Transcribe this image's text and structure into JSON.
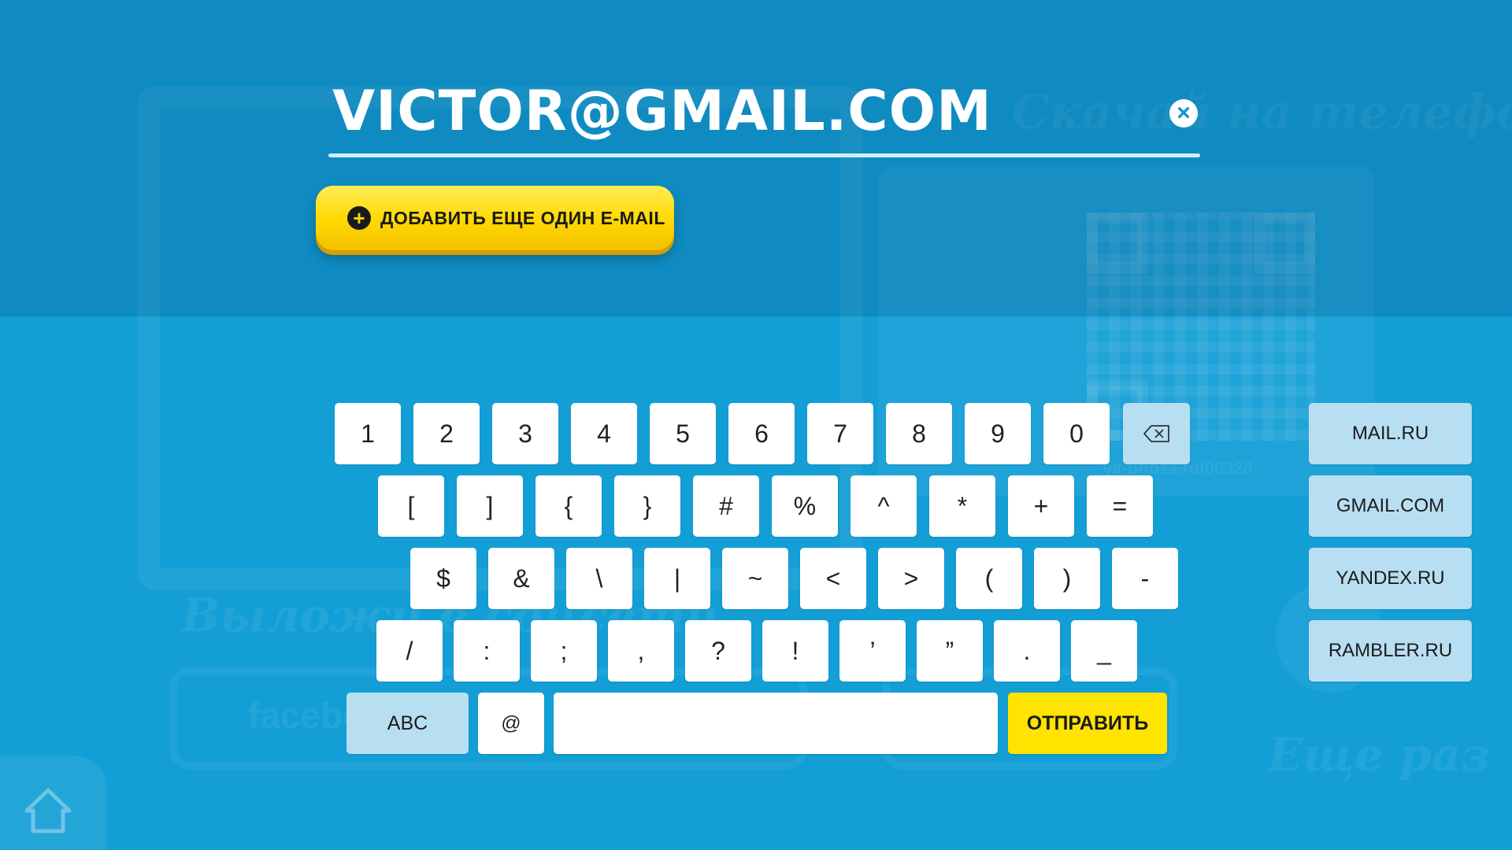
{
  "background": {
    "promo_text": "Скачай на телефон",
    "share_text": "Выложи в соцсети",
    "social_text": "facebook",
    "qr_url_text": "ya-booza.ru/00328",
    "again_text": "Еще раз"
  },
  "email": {
    "value": "VICTOR@GMAIL.COM",
    "clear_icon": "×"
  },
  "add_email": {
    "label": "ДОБАВИТЬ ЕЩЕ ОДИН E-MAIL",
    "icon": "+"
  },
  "keyboard": {
    "row1": [
      "1",
      "2",
      "3",
      "4",
      "5",
      "6",
      "7",
      "8",
      "9",
      "0"
    ],
    "row2": [
      "[",
      "]",
      "{",
      "}",
      "#",
      "%",
      "^",
      "*",
      "+",
      "="
    ],
    "row3": [
      "$",
      "&",
      "\\",
      "|",
      "~",
      "<",
      ">",
      "(",
      ")",
      "-"
    ],
    "row4": [
      "/",
      ":",
      ";",
      ",",
      "?",
      "!",
      "’",
      "”",
      ".",
      "_"
    ],
    "abc_label": "ABC",
    "at_label": "@",
    "send_label": "ОТПРАВИТЬ"
  },
  "domains": [
    "MAIL.RU",
    "GMAIL.COM",
    "YANDEX.RU",
    "RAMBLER.RU"
  ],
  "colors": {
    "background": "#139fd6",
    "key": "#ffffff",
    "key_secondary": "#b8def1",
    "accent_yellow": "#ffe400"
  }
}
